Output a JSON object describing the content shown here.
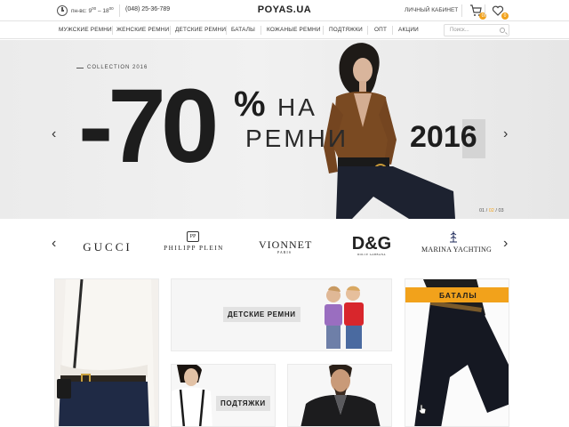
{
  "header": {
    "hours_text": "пн-вс: 9",
    "hours_from_sup": "00",
    "hours_dash": " – 18",
    "hours_to_sup": "00",
    "phone": "(048) 25-36-789",
    "logo": "POYAS.UA",
    "cabinet_label": "ЛИЧНЫЙ КАБИНЕТ",
    "cart_count": "0",
    "wishlist_count": "0"
  },
  "nav": {
    "items": [
      "МУЖСКИЕ РЕМНИ",
      "ЖЕНСКИЕ РЕМНИ",
      "ДЕТСКИЕ РЕМНИ",
      "БАТАЛЫ",
      "КОЖАНЫЕ РЕМНИ",
      "ПОДТЯЖКИ",
      "ОПТ",
      "АКЦИИ"
    ],
    "search_placeholder": "Поиск..."
  },
  "hero": {
    "collection": "COLLECTION 2016",
    "discount": "-70",
    "percent": "%",
    "line1": "НА",
    "line2": "РЕМНИ",
    "year": "2016",
    "prev_arrow": "‹",
    "next_arrow": "›",
    "slide_current": "02",
    "slide_first": "01",
    "slide_last": "03"
  },
  "brands": {
    "prev_arrow": "‹",
    "next_arrow": "›",
    "gucci": "GUCCI",
    "philipp_plein": "PHILIPP PLEIN",
    "philipp_plein_mark": "PP",
    "vionnet": "VIONNET",
    "vionnet_sub": "PARIS",
    "dg": "D&G",
    "dg_sub": "DOLCE GABBANA",
    "marina": "MARINA YACHTING"
  },
  "tiles": {
    "kids_label": "ДЕТСКИЕ РЕМНИ",
    "suspenders_label": "ПОДТЯЖКИ",
    "bataly_label": "БАТАЛЫ"
  },
  "colors": {
    "accent": "#f2a21b",
    "text_dark": "#1d1d1d",
    "hero_bg": "#ebebeb"
  }
}
